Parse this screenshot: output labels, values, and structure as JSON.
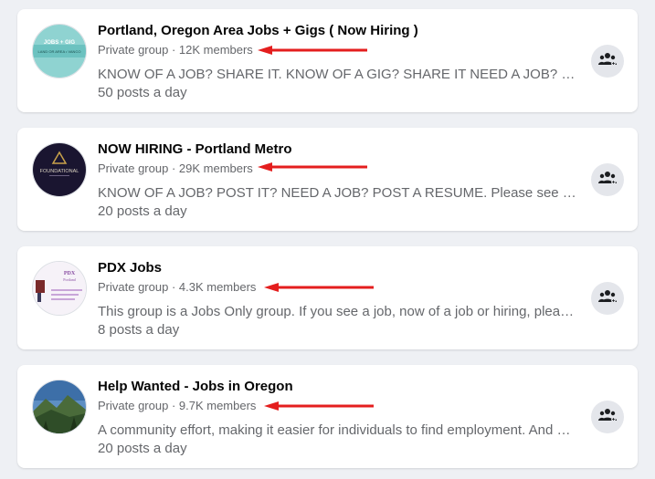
{
  "groups": [
    {
      "name": "Portland, Oregon Area Jobs + Gigs ( Now Hiring )",
      "privacy": "Private group",
      "members": "12K members",
      "description": "KNOW OF A JOB? SHARE IT. KNOW OF A GIG? SHARE IT NEED A JOB? SHARE IT...",
      "activity": "50 posts a day",
      "avatar_text": [
        "JOBS + GIG",
        "LAND OR AREA • VANCO"
      ],
      "avatar_color": "#8fd3d1"
    },
    {
      "name": "NOW HIRING - Portland Metro",
      "privacy": "Private group",
      "members": "29K members",
      "description": "KNOW OF A JOB? POST IT? NEED A JOB? POST A RESUME. Please see the rules...",
      "activity": "20 posts a day",
      "avatar_text": [
        "FOUNDATIONAL"
      ],
      "avatar_color": "#1a1530"
    },
    {
      "name": "PDX Jobs",
      "privacy": "Private group",
      "members": "4.3K members",
      "description": "This group is a Jobs Only group. If you see a job, now of a job or hiring, please post it...",
      "activity": "8 posts a day",
      "avatar_text": [
        "PDX",
        "Portland"
      ],
      "avatar_color": "#f6f2f8"
    },
    {
      "name": "Help Wanted - Jobs in Oregon",
      "privacy": "Private group",
      "members": "9.7K members",
      "description": "A community effort, making it easier for individuals to find employment. And employers...",
      "activity": "20 posts a day",
      "avatar_text": [],
      "avatar_color": "#3d6fa8"
    }
  ],
  "separator": " · ",
  "colors": {
    "arrow": "#e41e1e",
    "title": "#050505",
    "secondary": "#65676b",
    "button_bg": "#e4e6eb"
  },
  "icons": {
    "join": "group-people-icon",
    "annotation": "red-arrow-icon"
  }
}
